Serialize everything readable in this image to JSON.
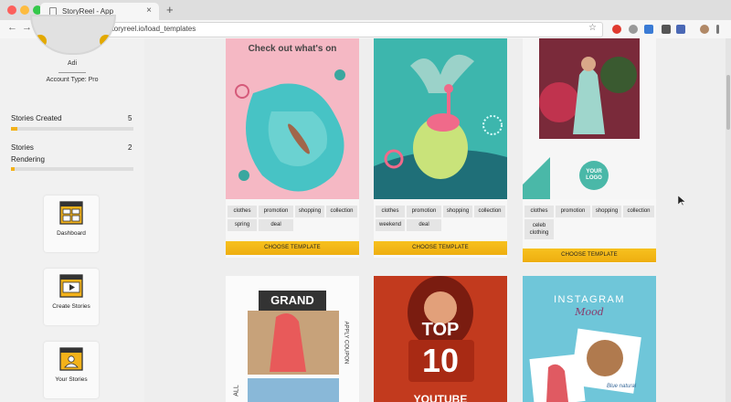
{
  "browser": {
    "tab_title": "StoryReel - App",
    "tab_close": "×",
    "new_tab": "+",
    "url": "https://app.storyreel.io/load_templates",
    "back": "←",
    "forward": "→",
    "reload": "C",
    "star": "☆",
    "info": "i"
  },
  "sidebar": {
    "user_name": "Adi",
    "account_type": "Account Type: Pro",
    "stats": [
      {
        "label": "Stories Created",
        "value": "5",
        "progress": 0.05
      },
      {
        "label": "Stories Rendering",
        "label_line1": "Stories",
        "label_line2": "Rendering",
        "value": "2",
        "progress": 0.03
      }
    ],
    "nav": [
      {
        "label": "Dashboard",
        "icon": "dashboard-icon"
      },
      {
        "label": "Create Stories",
        "icon": "create-stories-icon"
      },
      {
        "label": "Your Stories",
        "icon": "your-stories-icon"
      }
    ]
  },
  "templates": {
    "button_label": "CHOOSE TEMPLATE",
    "cards": [
      {
        "headline": "Check out what's on",
        "tags": [
          "clothes",
          "promotion",
          "shopping",
          "collection",
          "spring",
          "deal"
        ]
      },
      {
        "tags": [
          "clothes",
          "promotion",
          "shopping",
          "collection",
          "weekend",
          "deal"
        ]
      },
      {
        "badge_line1": "YOUR",
        "badge_line2": "LOGO",
        "tags": [
          "clothes",
          "promotion",
          "shopping",
          "collection",
          "celeb clothing"
        ],
        "tag_wrap_line1": "celeb",
        "tag_wrap_line2": "clothing"
      },
      {
        "headline": "GRAND",
        "side_text": "APPLY COUPON",
        "bottom_text": "ALL"
      },
      {
        "headline": "TOP",
        "number": "10",
        "bottom_text": "YOUTUBE"
      },
      {
        "headline": "INSTAGRAM",
        "script": "Mood",
        "caption": "Blue natural"
      }
    ]
  },
  "colors": {
    "accent": "#f3b21a",
    "button": "#f2b716",
    "teal": "#3cb7aa"
  }
}
